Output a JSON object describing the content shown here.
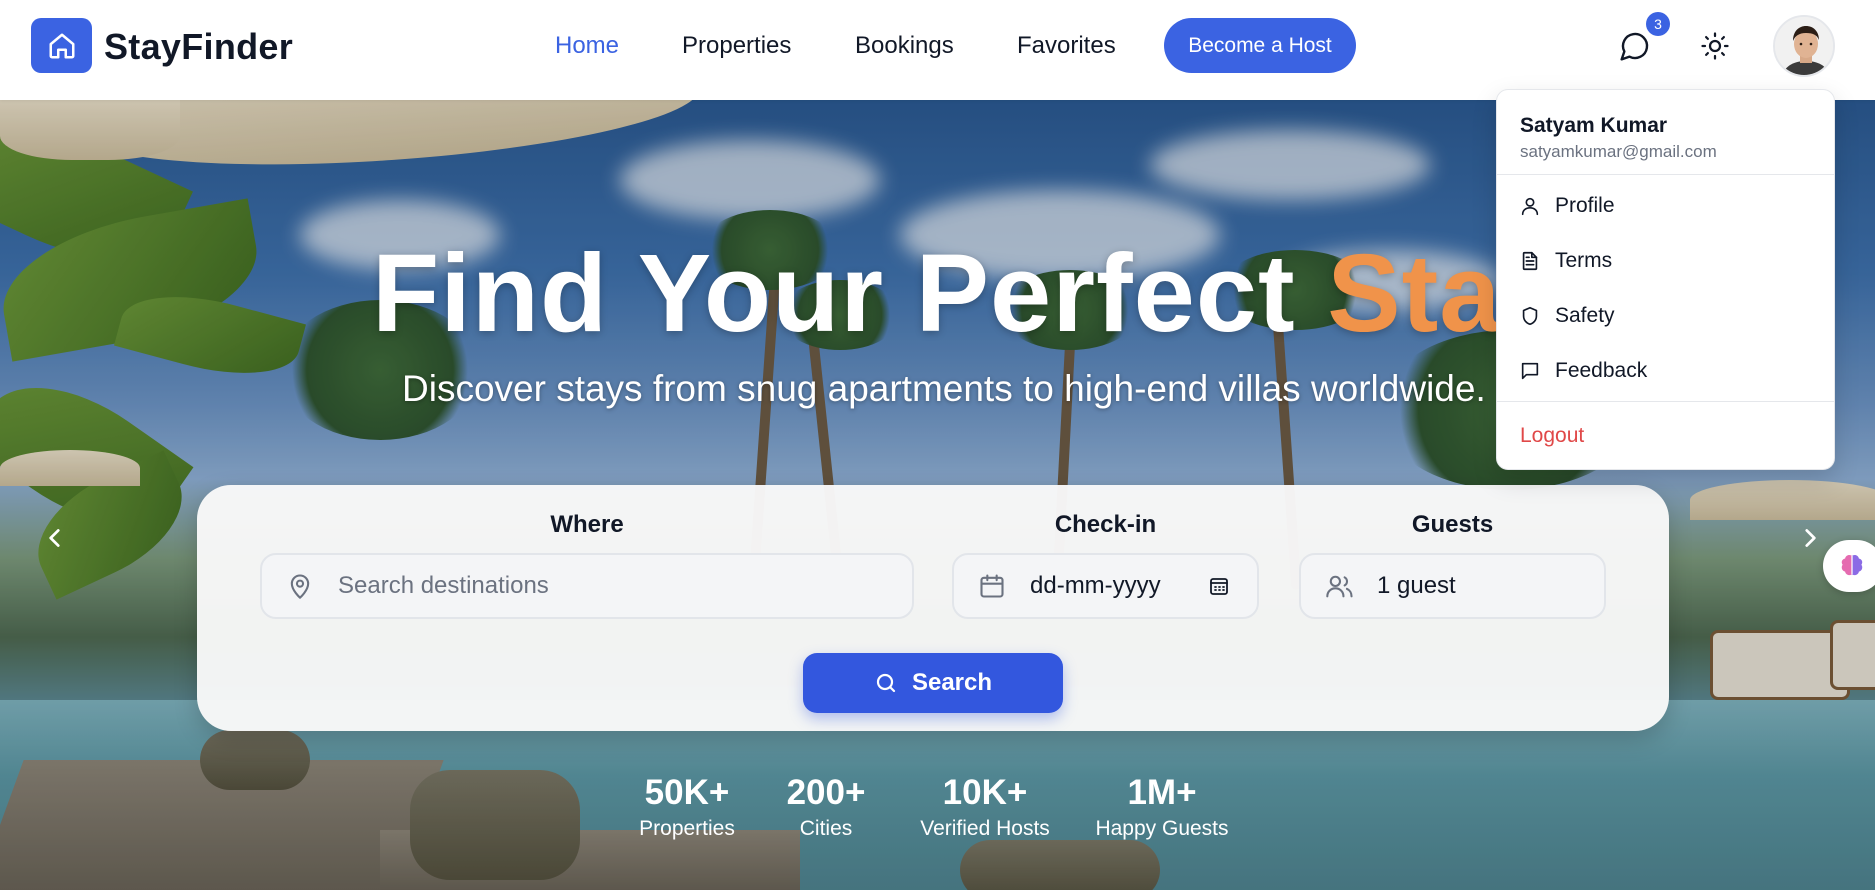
{
  "header": {
    "brand": "StayFinder",
    "nav": [
      {
        "label": "Home",
        "active": true
      },
      {
        "label": "Properties",
        "active": false
      },
      {
        "label": "Bookings",
        "active": false
      },
      {
        "label": "Favorites",
        "active": false
      }
    ],
    "host_button": "Become a Host",
    "messages_badge": "3",
    "brand_color": "#3b63e2"
  },
  "hero": {
    "title_main": "Find Your Perfect",
    "title_accent": "Stay",
    "accent_color": "#f0934a",
    "subtitle": "Discover stays from snug apartments to high-end villas worldwide."
  },
  "search": {
    "where_label": "Where",
    "where_placeholder": "Search destinations",
    "checkin_label": "Check-in",
    "checkin_value": "dd-mm-yyyy",
    "guests_label": "Guests",
    "guests_value": "1 guest",
    "button": "Search"
  },
  "stats": [
    {
      "num": "50K+",
      "label": "Properties"
    },
    {
      "num": "200+",
      "label": "Cities"
    },
    {
      "num": "10K+",
      "label": "Verified Hosts"
    },
    {
      "num": "1M+",
      "label": "Happy Guests"
    }
  ],
  "user_menu": {
    "name": "Satyam Kumar",
    "email": "satyamkumar@gmail.com",
    "items": [
      {
        "label": "Profile",
        "icon": "user-icon"
      },
      {
        "label": "Terms",
        "icon": "document-icon"
      },
      {
        "label": "Safety",
        "icon": "shield-icon"
      },
      {
        "label": "Feedback",
        "icon": "message-icon"
      }
    ],
    "logout": "Logout",
    "logout_color": "#e04848"
  }
}
